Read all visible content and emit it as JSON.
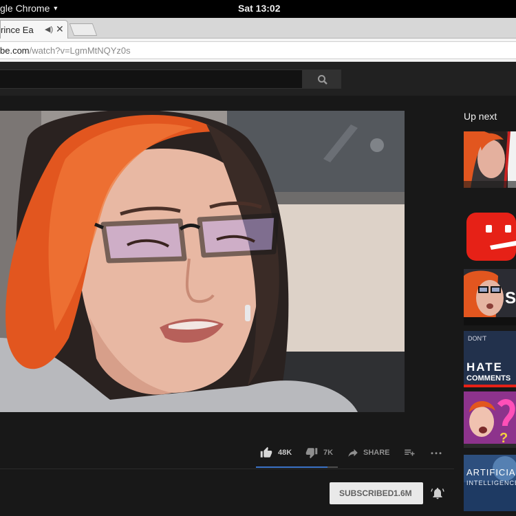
{
  "system_bar": {
    "app_menu": "gle Chrome",
    "clock": "Sat 13:02"
  },
  "browser": {
    "tab_title": "rince Ea",
    "url_host": "be.com",
    "url_path": "/watch?v=LgmMtNQYz0s"
  },
  "icons": {
    "tab_audio": "speaker-icon",
    "tab_close": "close-icon",
    "search": "search-icon",
    "like": "thumb-up-icon",
    "dislike": "thumb-down-icon",
    "share": "share-arrow-icon",
    "save": "add-to-playlist-icon",
    "more": "more-dots-icon",
    "bell": "bell-icon"
  },
  "video": {
    "like_count": "48K",
    "dislike_count": "7K",
    "share_label": "SHARE",
    "like_ratio": 0.87
  },
  "channel": {
    "subscribe_label": "SUBSCRIBED",
    "subscriber_count": "1.6M"
  },
  "sidebar": {
    "heading": "Up next",
    "thumbnails": [
      {
        "label": ""
      },
      {
        "label": ""
      },
      {
        "label": "S"
      },
      {
        "label": "HATE"
      },
      {
        "label": ""
      },
      {
        "label": "ARTIFICIA"
      }
    ],
    "thumb4_caption_top": "DON'T",
    "thumb4_caption_bottom": "COMMENTS",
    "thumb6_caption_bottom": "INTELLIGENCE"
  },
  "colors": {
    "accent_blue": "#3b73c8",
    "yt_red": "#e62117",
    "hair_orange": "#e2561f"
  }
}
